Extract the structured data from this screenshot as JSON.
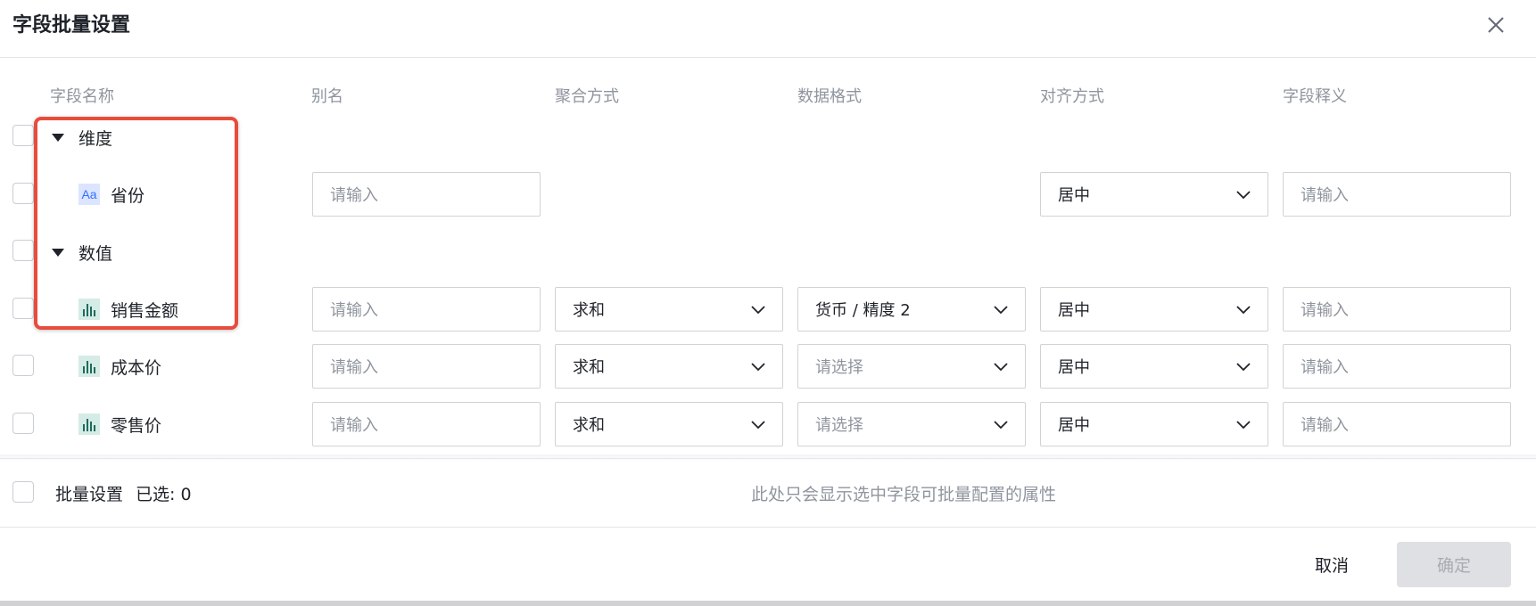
{
  "dialog": {
    "title": "字段批量设置"
  },
  "columns": {
    "name": "字段名称",
    "alias": "别名",
    "aggregation": "聚合方式",
    "format": "数据格式",
    "align": "对齐方式",
    "description": "字段释义"
  },
  "groups": {
    "dimension": "维度",
    "measure": "数值"
  },
  "rows": [
    {
      "label": "省份",
      "icon": "text-type-icon",
      "alias_placeholder": "请输入",
      "align": "居中",
      "desc_placeholder": "请输入"
    },
    {
      "label": "销售金额",
      "icon": "bar-chart-icon",
      "alias_placeholder": "请输入",
      "aggregation": "求和",
      "format": "货币 / 精度 2",
      "align": "居中",
      "desc_placeholder": "请输入"
    },
    {
      "label": "成本价",
      "icon": "bar-chart-icon",
      "alias_placeholder": "请输入",
      "aggregation": "求和",
      "format_placeholder": "请选择",
      "align": "居中",
      "desc_placeholder": "请输入"
    },
    {
      "label": "零售价",
      "icon": "bar-chart-icon",
      "alias_placeholder": "请输入",
      "aggregation": "求和",
      "format_placeholder": "请选择",
      "align": "居中",
      "desc_placeholder": "请输入"
    }
  ],
  "batch": {
    "label": "批量设置",
    "selected": "已选: 0",
    "hint": "此处只会显示选中字段可批量配置的属性"
  },
  "buttons": {
    "cancel": "取消",
    "ok": "确定"
  },
  "colors": {
    "highlight": "#e74c3c",
    "text_placeholder": "#8f959e",
    "border": "#d0d3d6"
  }
}
